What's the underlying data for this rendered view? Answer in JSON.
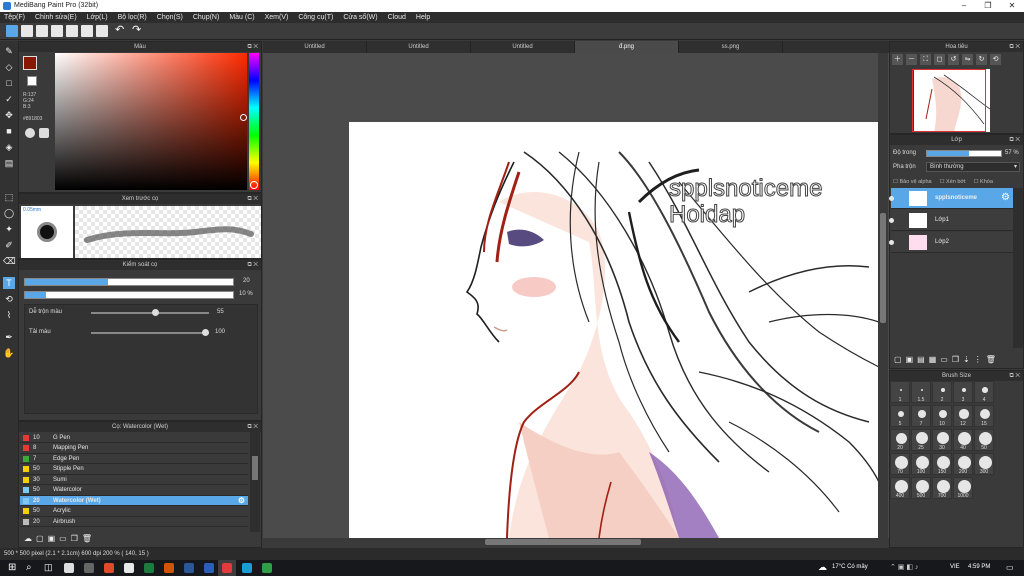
{
  "app": {
    "title": "MediBang Paint Pro (32bit)"
  },
  "menu": [
    "Tệp(F)",
    "Chỉnh sửa(E)",
    "Lớp(L)",
    "Bộ lọc(R)",
    "Chọn(S)",
    "Chụp(N)",
    "Màu (C)",
    "Xem(V)",
    "Công cụ(T)",
    "Cửa sổ(W)",
    "Cloud",
    "Help"
  ],
  "panels": {
    "color": {
      "title": "Màu",
      "r": "R:137",
      "g": "G:24",
      "b": "B:3",
      "hex": "#891803",
      "current": "#891803"
    },
    "brush_preview": {
      "title": "Xem trước cọ",
      "size": "0.05mm"
    },
    "brush_control": {
      "title": "Kiểm soát cọ",
      "size_value": "20",
      "opacity_value": "10 %",
      "mix_label": "Dễ trộn màu",
      "mix_value": "55",
      "reload_label": "Tải màu",
      "reload_value": "100",
      "size_fraction": 0.4,
      "opacity_fraction": 0.1,
      "mix_fraction": 0.55,
      "reload_fraction": 1.0
    },
    "brush_list": {
      "title": "Cọ: Watercolor (Wet)",
      "items": [
        {
          "num": "10",
          "name": "G Pen",
          "color": "#e53935"
        },
        {
          "num": "8",
          "name": "Mapping Pen",
          "color": "#e53935"
        },
        {
          "num": "7",
          "name": "Edge Pen",
          "color": "#3aa83a"
        },
        {
          "num": "50",
          "name": "Stipple Pen",
          "color": "#f5d000"
        },
        {
          "num": "30",
          "name": "Sumi",
          "color": "#f5d000"
        },
        {
          "num": "50",
          "name": "Watercolor",
          "color": "#7fc8f2"
        },
        {
          "num": "20",
          "name": "Watercolor (Wet)",
          "color": "#7fc8f2"
        },
        {
          "num": "50",
          "name": "Acrylic",
          "color": "#f5d000"
        },
        {
          "num": "20",
          "name": "Airbrush",
          "color": "#bbbbbb"
        }
      ]
    },
    "navigator": {
      "title": "Hoa tiêu"
    },
    "layers": {
      "title": "Lớp",
      "opacity_label": "Độ trong",
      "opacity_value": "57 %",
      "opacity_fraction": 0.57,
      "blend_label": "Pha trộn",
      "blend_value": "Bình thường",
      "protect_alpha": "Bảo vệ alpha",
      "clipping": "Xén bớt",
      "lock": "Khóa",
      "items": [
        {
          "name": "spplsnoticeme"
        },
        {
          "name": "Lớp1"
        },
        {
          "name": "Lớp2"
        }
      ]
    },
    "brush_size": {
      "title": "Brush Size",
      "rows": [
        [
          "1",
          "1.5",
          "2",
          "3",
          "4"
        ],
        [
          "5",
          "7",
          "10",
          "12",
          "15"
        ],
        [
          "20",
          "25",
          "30",
          "40",
          "50"
        ],
        [
          "70",
          "100",
          "150",
          "200",
          "300"
        ],
        [
          "400",
          "500",
          "700",
          "1000"
        ]
      ]
    }
  },
  "tabs": [
    "Untitled",
    "Untitled",
    "Untitled",
    "đ.png",
    "ss.png"
  ],
  "active_tab": 3,
  "canvas": {
    "watermark_line1": "spplsnoticeme",
    "watermark_line2": "Hoidap"
  },
  "status": {
    "text": "500 * 500 pixel   (2.1 * 2.1cm)  600 dpi  200 %  ( 140, 15 )"
  },
  "taskbar": {
    "weather": "17°C  Có mây",
    "lang": "VIE",
    "time": "4:59 PM"
  }
}
